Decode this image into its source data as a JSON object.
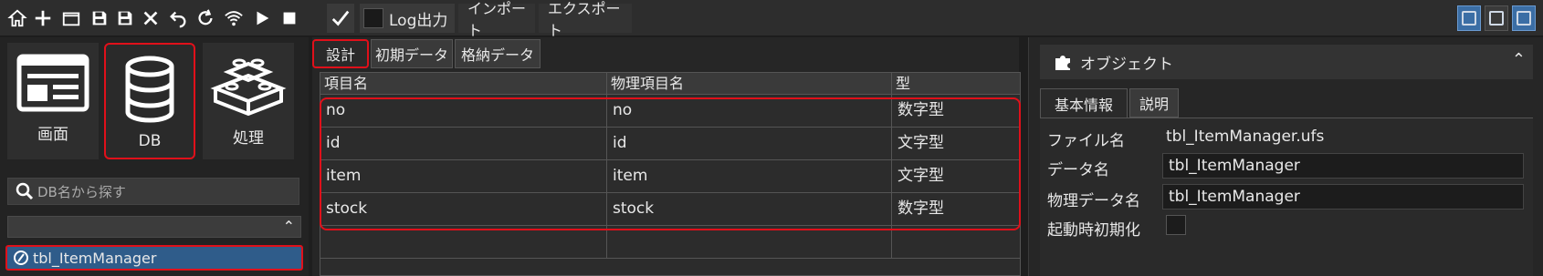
{
  "toolbar": {
    "icons": [
      "home-icon",
      "plus-icon",
      "open-folder-icon",
      "save-icon",
      "save-all-icon",
      "close-icon",
      "undo-icon",
      "refresh-icon",
      "wifi-icon",
      "play-icon",
      "stop-icon",
      "check-icon"
    ],
    "log_label": "Log出力",
    "menu_import": "インポート",
    "menu_export": "エクスポート"
  },
  "left": {
    "categories": [
      {
        "label": "画面",
        "icon": "screen-icon"
      },
      {
        "label": "DB",
        "icon": "database-icon"
      },
      {
        "label": "処理",
        "icon": "blocks-icon"
      }
    ],
    "search_placeholder": "DB名から探す",
    "tree_item": "tbl_ItemManager"
  },
  "middle": {
    "tabs": [
      "設計",
      "初期データ",
      "格納データ"
    ],
    "columns": [
      "項目名",
      "物理項目名",
      "型"
    ],
    "rows": [
      [
        "no",
        "no",
        "数字型"
      ],
      [
        "id",
        "id",
        "文字型"
      ],
      [
        "item",
        "item",
        "文字型"
      ],
      [
        "stock",
        "stock",
        "数字型"
      ],
      [
        "",
        "",
        ""
      ]
    ]
  },
  "right": {
    "header": "オブジェクト",
    "tabs": [
      "基本情報",
      "説明"
    ],
    "file_name_label": "ファイル名",
    "file_name_value": "tbl_ItemManager.ufs",
    "data_name_label": "データ名",
    "data_name_value": "tbl_ItemManager",
    "physical_name_label": "物理データ名",
    "physical_name_value": "tbl_ItemManager",
    "init_on_start_label": "起動時初期化"
  },
  "colors": {
    "accent_blue": "#2f5c8a",
    "highlight_red": "#e0101a"
  }
}
